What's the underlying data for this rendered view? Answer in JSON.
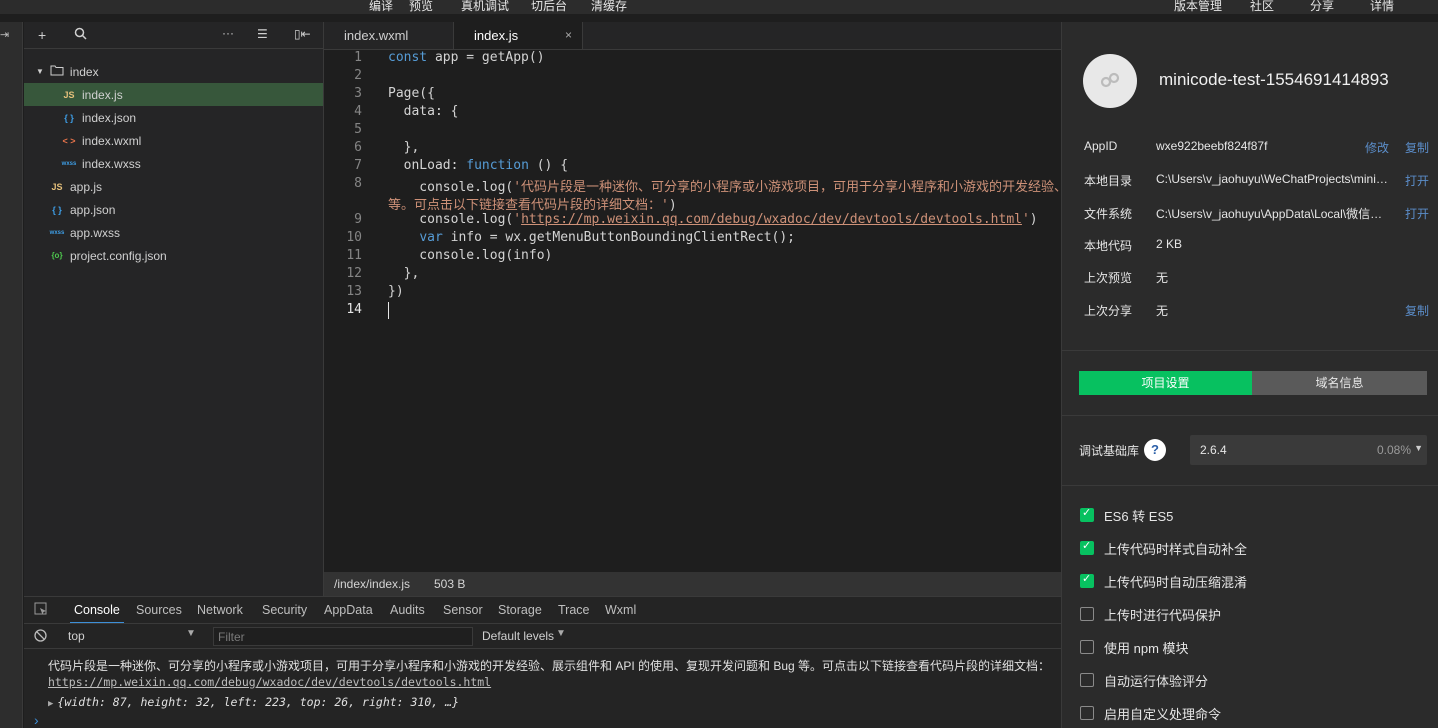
{
  "menu": {
    "edit": "编译",
    "preview": "预览",
    "remote_debug": "真机调试",
    "backend": "切后台",
    "clear_cache": "清缓存",
    "version": "版本管理",
    "community": "社区",
    "share": "分享",
    "details": "详情"
  },
  "explorer": {
    "folder": "index",
    "files": [
      "index.js",
      "index.json",
      "index.wxml",
      "index.wxss",
      "app.js",
      "app.json",
      "app.wxss",
      "project.config.json"
    ],
    "icons": {
      "js": "JS",
      "json": "{ }",
      "wxml": "< >",
      "wxss": "wxss",
      "config": "{o}"
    }
  },
  "tabs": [
    {
      "label": "index.wxml"
    },
    {
      "label": "index.js",
      "close": "×"
    }
  ],
  "code": {
    "line_numbers": [
      "1",
      "2",
      "3",
      "4",
      "5",
      "6",
      "7",
      "8",
      "",
      "9",
      "10",
      "11",
      "12",
      "13",
      "14"
    ],
    "l1_kw": "const",
    "l1_rest": " app = getApp()",
    "l3": "Page({",
    "l4": "  data: {",
    "l6": "  },",
    "l7_a": "  onLoad: ",
    "l7_kw": "function",
    "l7_b": " () {",
    "l8_a": "    console.log(",
    "l8_str": "'代码片段是一种迷你、可分享的小程序或小游戏项目，可用于分享小程序和小游戏的开发经验、展示组件和 API 的使用、复现开发问题和 Bug",
    "l8b_str": "等。可点击以下链接查看代码片段的详细文档：'",
    "l8b_end": ")",
    "l9_a": "    console.log(",
    "l9_q1": "'",
    "l9_url": "https://mp.weixin.qq.com/debug/wxadoc/dev/devtools/devtools.html",
    "l9_q2": "'",
    "l9_end": ")",
    "l10_kw": "var",
    "l10_a": "    ",
    "l10_b": " info = wx.getMenuButtonBoundingClientRect();",
    "l11": "    console.log(info)",
    "l12": "  },",
    "l13": "})"
  },
  "status": {
    "path": "/index/index.js",
    "size": "503 B"
  },
  "devtools": {
    "tabs": [
      "Console",
      "Sources",
      "Network",
      "Security",
      "AppData",
      "Audits",
      "Sensor",
      "Storage",
      "Trace",
      "Wxml"
    ],
    "context": "top",
    "filter_placeholder": "Filter",
    "levels": "Default levels",
    "log1": "代码片段是一种迷你、可分享的小程序或小游戏项目，可用于分享小程序和小游戏的开发经验、展示组件和 API 的使用、复现开发问题和 Bug 等。可点击以下链接查看代码片段的详细文档：",
    "log2": "https://mp.weixin.qq.com/debug/wxadoc/dev/devtools/devtools.html",
    "log3": "{width: 87, height: 32, left: 223, top: 26, right: 310, …}",
    "prompt": "›"
  },
  "project": {
    "name": "minicode-test-1554691414893",
    "rows": [
      {
        "label": "AppID",
        "value": "wxe922beebf824f87f",
        "action1": "修改",
        "action2": "复制"
      },
      {
        "label": "本地目录",
        "value": "C:\\Users\\v_jaohuyu\\WeChatProjects\\minicode-test",
        "action2": "打开"
      },
      {
        "label": "文件系统",
        "value": "C:\\Users\\v_jaohuyu\\AppData\\Local\\微信web开发者工具",
        "action2": "打开"
      },
      {
        "label": "本地代码",
        "value": "2 KB"
      },
      {
        "label": "上次预览",
        "value": "无"
      },
      {
        "label": "上次分享",
        "value": "无",
        "action2": "复制"
      }
    ],
    "btn_settings": "项目设置",
    "btn_domain": "域名信息",
    "lib_label": "调试基础库",
    "lib_help": "?",
    "lib_version": "2.6.4",
    "lib_percent": "0.08%",
    "options": [
      {
        "label": "ES6 转 ES5",
        "checked": true
      },
      {
        "label": "上传代码时样式自动补全",
        "checked": true
      },
      {
        "label": "上传代码时自动压缩混淆",
        "checked": true
      },
      {
        "label": "上传时进行代码保护",
        "checked": false
      },
      {
        "label": "使用 npm 模块",
        "checked": false
      },
      {
        "label": "自动运行体验评分",
        "checked": false
      },
      {
        "label": "启用自定义处理命令",
        "checked": false
      }
    ]
  },
  "colors": {
    "accent_green": "#07c160",
    "link_blue": "#5b8dc9",
    "selection": "#37573b"
  }
}
